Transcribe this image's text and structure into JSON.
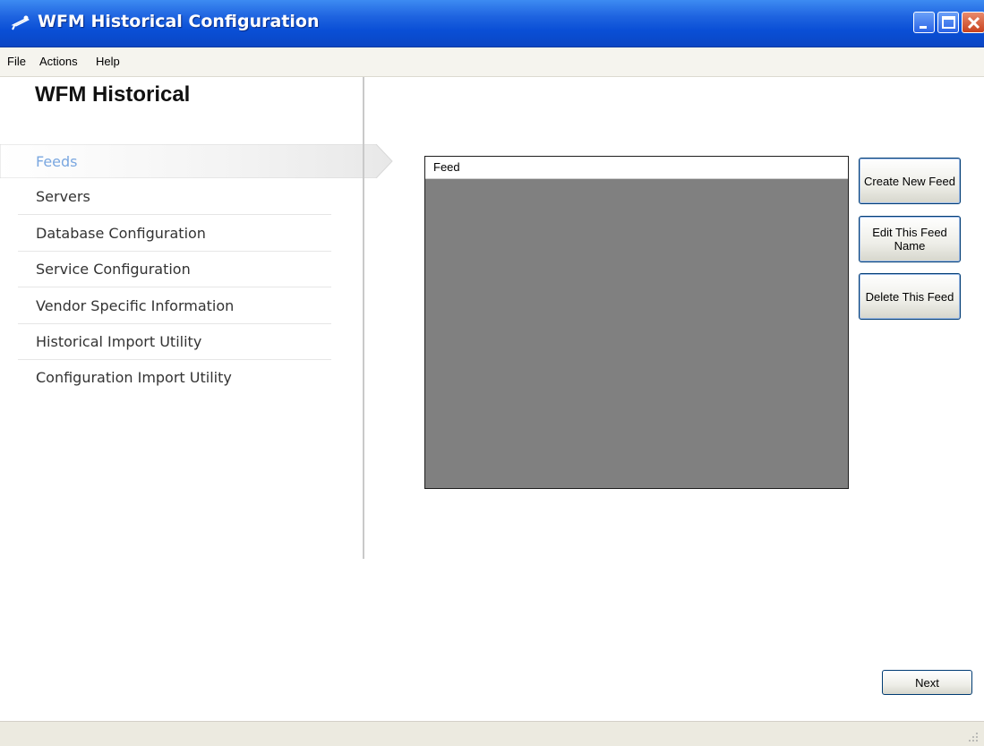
{
  "window": {
    "title": "WFM Historical Configuration",
    "icons": {
      "app": "satellite-dish-icon",
      "minimize": "minimize-icon",
      "maximize": "maximize-icon",
      "close": "close-icon"
    }
  },
  "menu": {
    "items": [
      "File",
      "Actions",
      "Help"
    ]
  },
  "sidebar": {
    "heading": "WFM Historical",
    "items": [
      {
        "label": "Feeds",
        "selected": true
      },
      {
        "label": "Servers"
      },
      {
        "label": "Database Configuration"
      },
      {
        "label": "Service Configuration"
      },
      {
        "label": "Vendor Specific Information"
      },
      {
        "label": "Historical Import Utility"
      },
      {
        "label": "Configuration Import Utility"
      }
    ]
  },
  "feeds": {
    "column_header": "Feed",
    "rows": []
  },
  "buttons": {
    "create": "Create New Feed",
    "edit": "Edit This Feed Name",
    "delete": "Delete This Feed",
    "next": "Next"
  },
  "colors": {
    "titlebar": "#0a4fd6",
    "selected_nav_text": "#7aa7e0",
    "list_background": "#808080"
  }
}
